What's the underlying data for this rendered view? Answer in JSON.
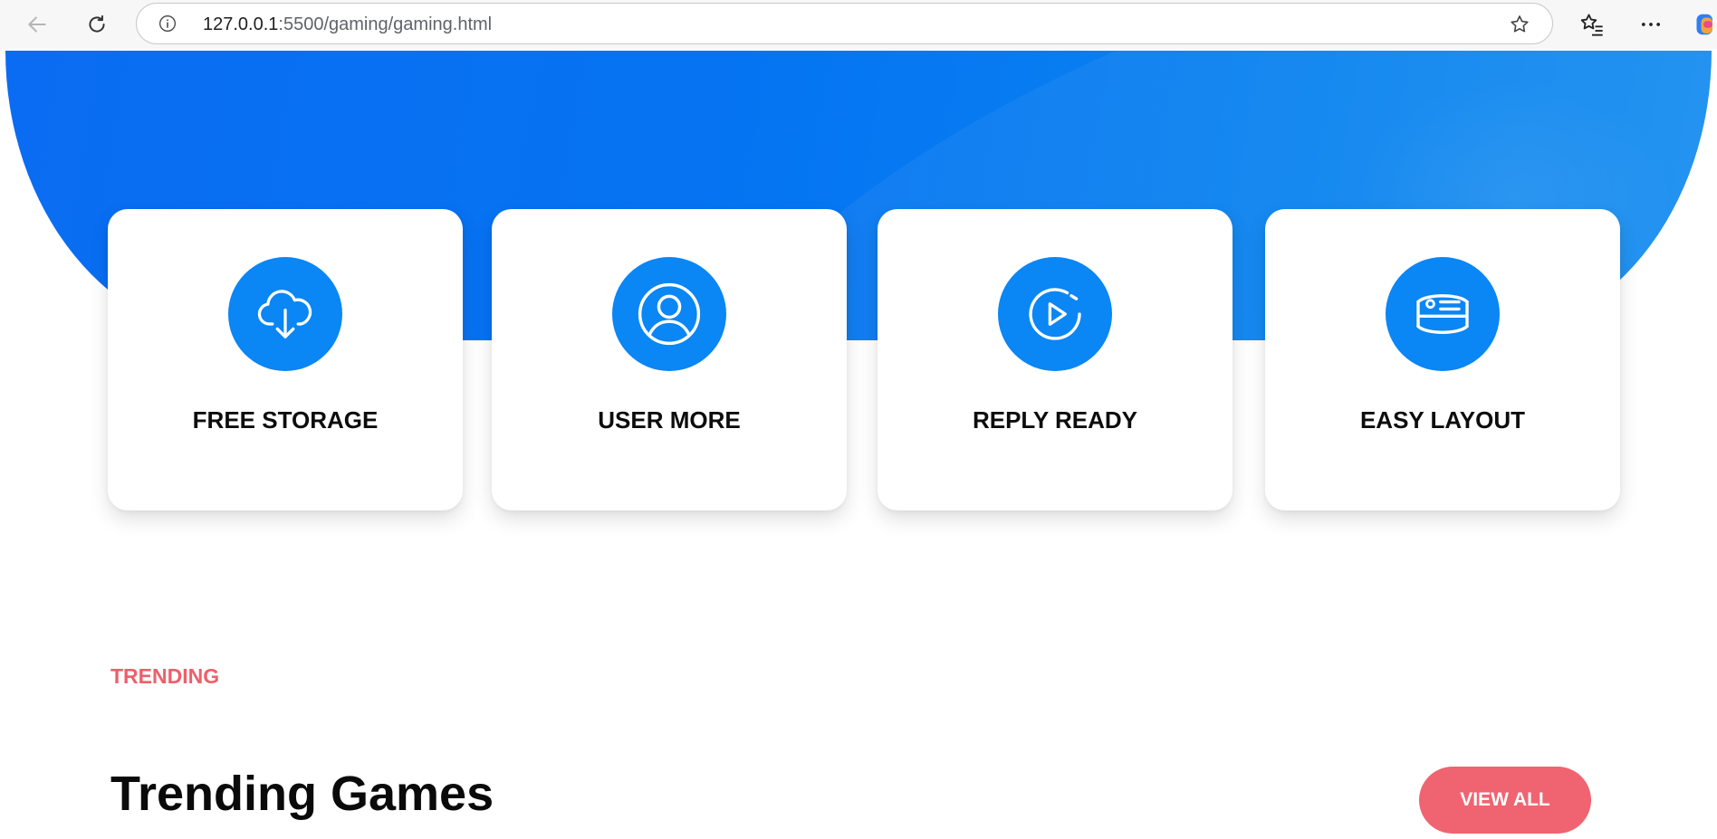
{
  "browser": {
    "url_host": "127.0.0.1",
    "url_rest": ":5500/gaming/gaming.html",
    "icons": [
      "back-icon",
      "refresh-icon",
      "info-icon",
      "star-icon",
      "favorites-icon",
      "more-icon",
      "copilot-icon"
    ]
  },
  "features": [
    {
      "title": "FREE STORAGE",
      "icon": "cloud-download-icon"
    },
    {
      "title": "USER MORE",
      "icon": "user-icon"
    },
    {
      "title": "REPLY READY",
      "icon": "play-circle-icon"
    },
    {
      "title": "EASY LAYOUT",
      "icon": "layout-card-icon"
    }
  ],
  "trending": {
    "eyebrow": "TRENDING",
    "title": "Trending Games",
    "view_all_label": "VIEW ALL"
  },
  "colors": {
    "primary_blue": "#0a86f5",
    "hero_blue": "#0575f2",
    "accent_red": "#ef6470"
  }
}
